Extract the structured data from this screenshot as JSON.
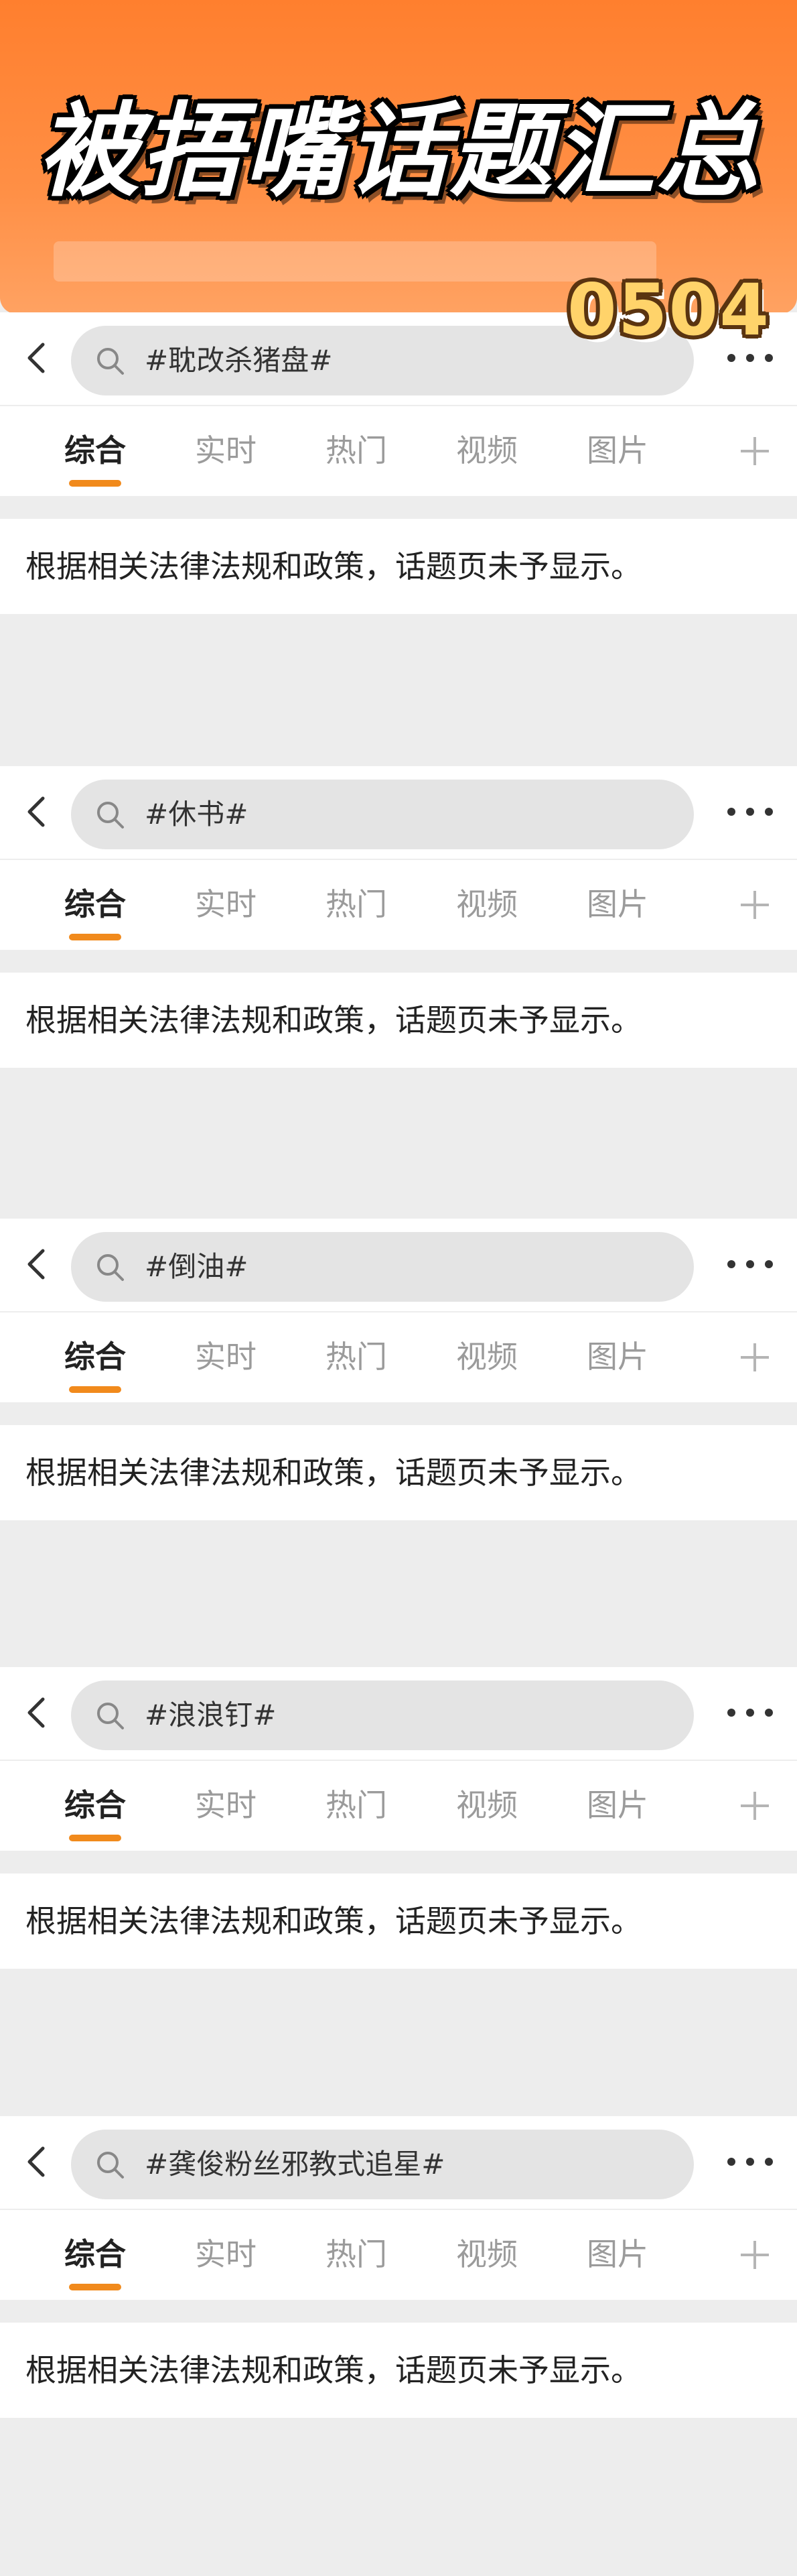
{
  "banner": {
    "title": "被捂嘴话题汇总",
    "code": "0504",
    "colors": {
      "background": "#ff8a3d",
      "title": "#ffffff",
      "code": "#ffd36a"
    }
  },
  "tabs": [
    "综合",
    "实时",
    "热门",
    "视频",
    "图片"
  ],
  "active_tab": "综合",
  "accent_color": "#f18a1c",
  "icons": {
    "back": "chevron-left-icon",
    "search": "search-icon",
    "more": "more-dots-icon",
    "add": "plus-icon"
  },
  "notice_text": "根据相关法律法规和政策，话题页未予显示。",
  "sections": [
    {
      "query": "#耽改杀猪盘#"
    },
    {
      "query": "#休书#"
    },
    {
      "query": "#倒油#"
    },
    {
      "query": "#浪浪钉#"
    },
    {
      "query": "#龚俊粉丝邪教式追星#"
    }
  ]
}
